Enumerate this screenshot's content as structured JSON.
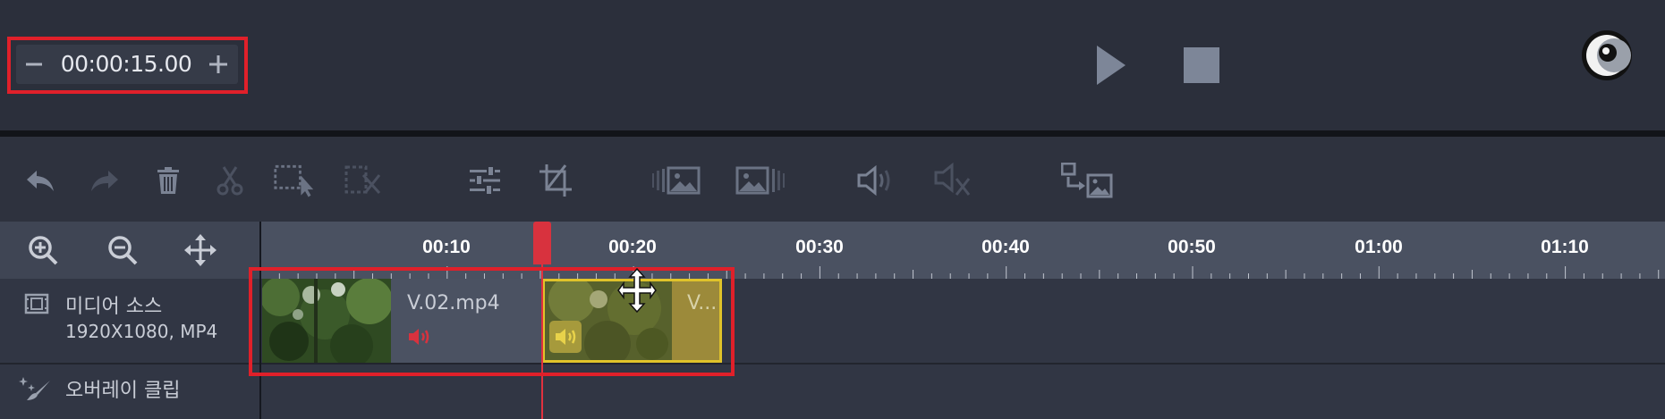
{
  "preview": {
    "time_value": "00:00:15.00",
    "minus_icon": "minus-icon",
    "plus_icon": "plus-icon",
    "play_icon": "play-icon",
    "stop_icon": "stop-icon",
    "theme_icon": "moon-icon"
  },
  "toolbar": {
    "icons": [
      "undo-icon",
      "redo-icon",
      "delete-icon",
      "cut-icon",
      "select-icon",
      "split-icon",
      "adjust-icon",
      "crop-icon",
      "fade-in-icon",
      "fade-out-icon",
      "volume-icon",
      "mute-icon",
      "replace-icon"
    ]
  },
  "timeline": {
    "zoom_icons": [
      "zoom-in-icon",
      "zoom-out-icon",
      "move-icon"
    ],
    "ruler_labels": [
      "00:10",
      "00:20",
      "00:30",
      "00:40",
      "00:50",
      "01:00",
      "01:10"
    ],
    "tracks": [
      {
        "name": "미디어 소스",
        "detail": "1920X1080, MP4",
        "icon": "film-icon"
      },
      {
        "name": "오버레이 클립",
        "icon": "sparkle-icon"
      }
    ],
    "clips": [
      {
        "name": "V.02.mp4",
        "audio_icon": "speaker-icon"
      },
      {
        "name": "V...",
        "audio_icon": "speaker-icon"
      }
    ]
  },
  "colors": {
    "accent_red": "#e0202a",
    "playhead": "#e0313e",
    "selected_clip_border": "#e0c32a"
  }
}
